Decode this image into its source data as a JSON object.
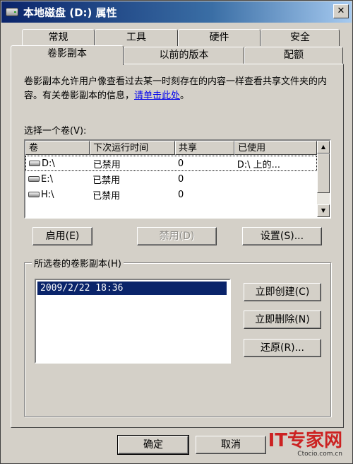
{
  "window": {
    "title": "本地磁盘 (D:) 属性"
  },
  "tabs_back": [
    "常规",
    "工具",
    "硬件",
    "安全"
  ],
  "tabs_front": [
    "卷影副本",
    "以前的版本",
    "配额"
  ],
  "active_tab": "卷影副本",
  "description": {
    "text": "卷影副本允许用户像查看过去某一时刻存在的内容一样查看共享文件夹的内容。有关卷影副本的信息，",
    "link": "请单击此处",
    "tail": "。"
  },
  "volumes_label": "选择一个卷(V):",
  "volumes_columns": [
    "卷",
    "下次运行时间",
    "共享",
    "已使用"
  ],
  "volumes_rows": [
    {
      "volume": "D:\\",
      "next_run": "已禁用",
      "shares": "0",
      "used": "D:\\ 上的..."
    },
    {
      "volume": "E:\\",
      "next_run": "已禁用",
      "shares": "0",
      "used": ""
    },
    {
      "volume": "H:\\",
      "next_run": "已禁用",
      "shares": "0",
      "used": ""
    }
  ],
  "buttons": {
    "enable": "启用(E)",
    "disable": "禁用(D)",
    "settings": "设置(S)...",
    "create_now": "立即创建(C)",
    "delete_now": "立即删除(N)",
    "revert": "还原(R)...",
    "ok": "确定",
    "cancel": "取消"
  },
  "snapshots_label": "所选卷的卷影副本(H)",
  "snapshots": [
    "2009/2/22 18:36"
  ],
  "watermark": {
    "logo": "IT专家网",
    "sub": "Ctocio.com.cn"
  }
}
